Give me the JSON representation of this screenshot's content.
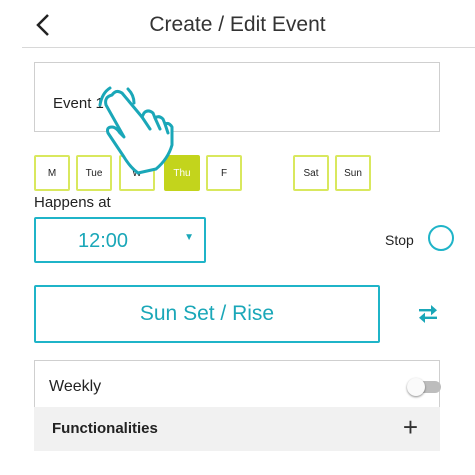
{
  "header": {
    "title": "Create / Edit Event",
    "back_icon": "chevron-left-icon"
  },
  "event_name": {
    "value": "Event 1"
  },
  "days": [
    {
      "label": "M",
      "active": false
    },
    {
      "label": "Tue",
      "active": false
    },
    {
      "label": "W",
      "active": false
    },
    {
      "label": "Thu",
      "active": true
    },
    {
      "label": "F",
      "active": false
    },
    {
      "label": "Sat",
      "active": false
    },
    {
      "label": "Sun",
      "active": false
    }
  ],
  "happens_at": {
    "label": "Happens at",
    "time_value": "12:00"
  },
  "stop": {
    "label": "Stop",
    "checked": false
  },
  "sun_button": {
    "label": "Sun Set / Rise",
    "swap_icon": "swap-arrows-icon"
  },
  "weekly": {
    "label": "Weekly",
    "enabled": false
  },
  "functionalities": {
    "label": "Functionalities",
    "plus": "+"
  },
  "colors": {
    "accent_teal": "#1fb4c8",
    "day_border": "#d9e85e",
    "day_active": "#c3d41c"
  }
}
